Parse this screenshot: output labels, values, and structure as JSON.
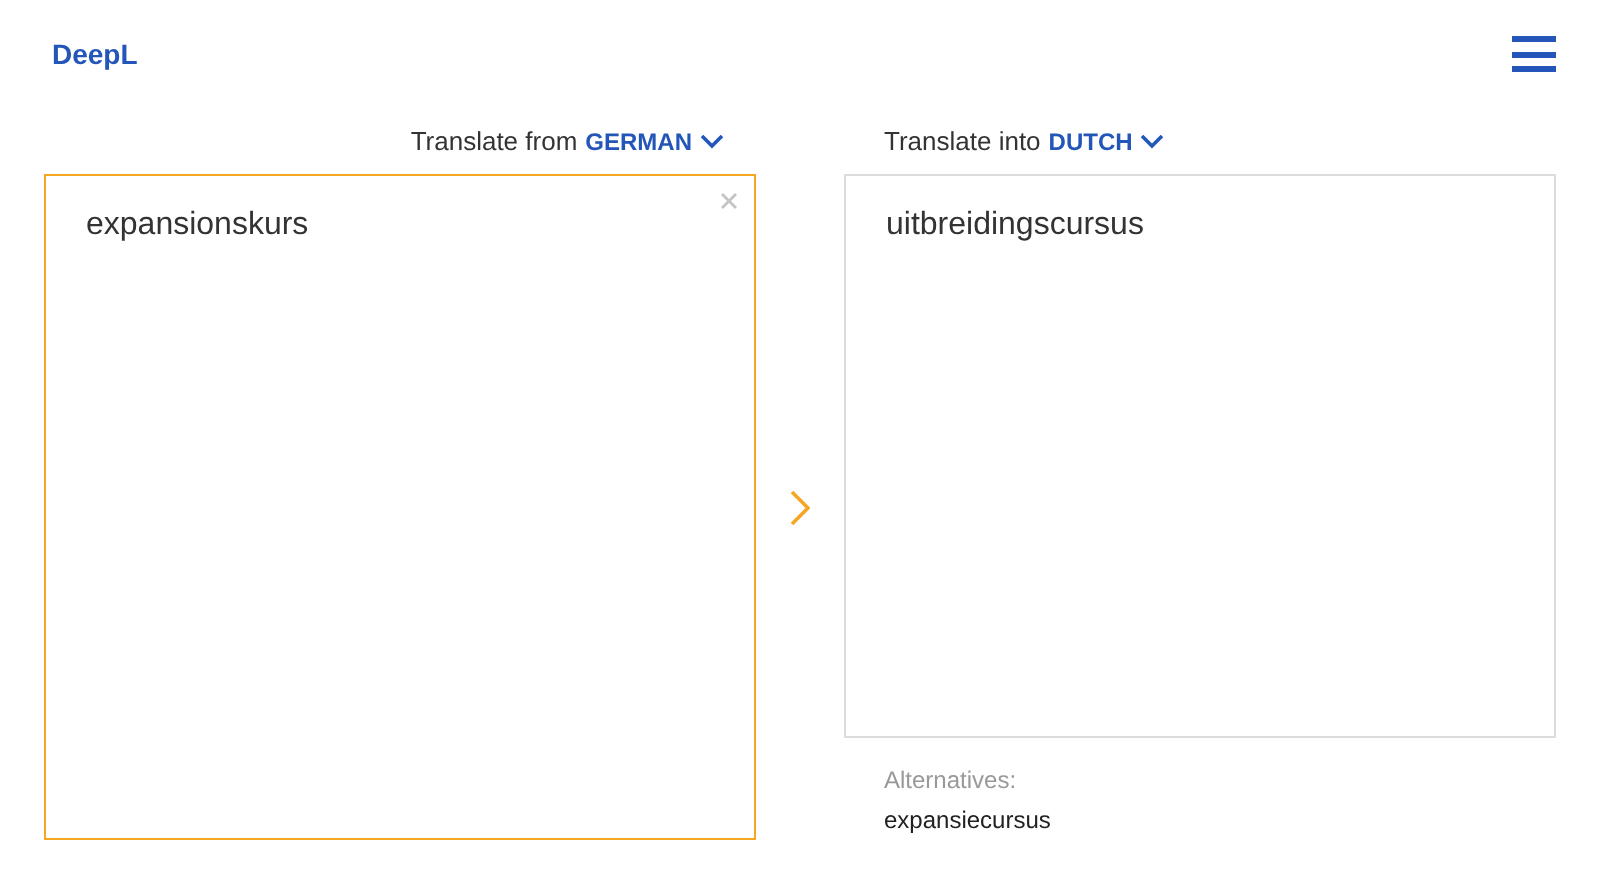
{
  "header": {
    "logo": "DeepL"
  },
  "source": {
    "label": "Translate from",
    "language": "GERMAN",
    "text": "expansionskurs",
    "focused": true
  },
  "target": {
    "label": "Translate into",
    "language": "DUTCH",
    "text": "uitbreidingscursus"
  },
  "alternatives": {
    "label": "Alternatives:",
    "items": [
      "expansiecursus"
    ]
  }
}
